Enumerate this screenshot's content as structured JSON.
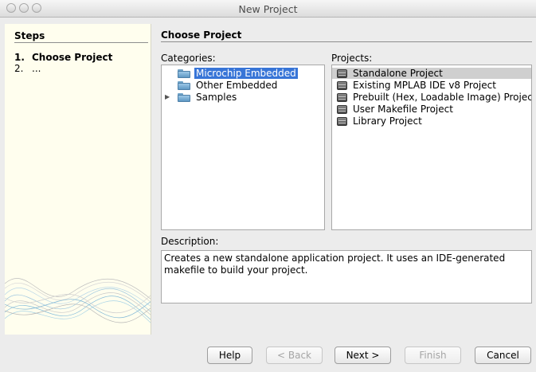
{
  "window": {
    "title": "New Project"
  },
  "steps": {
    "heading": "Steps",
    "items": [
      {
        "num": "1.",
        "label": "Choose Project"
      },
      {
        "num": "2.",
        "label": "..."
      }
    ]
  },
  "main": {
    "heading": "Choose Project",
    "categories_label": "Categories:",
    "projects_label": "Projects:",
    "categories": [
      {
        "label": "Microchip Embedded",
        "icon": "folder-icon",
        "selected": true
      },
      {
        "label": "Other Embedded",
        "icon": "folder-icon",
        "selected": false
      },
      {
        "label": "Samples",
        "icon": "folder-icon",
        "selected": false,
        "expandable": true
      }
    ],
    "projects": [
      {
        "label": "Standalone Project",
        "icon": "chip-icon",
        "selected": true
      },
      {
        "label": "Existing MPLAB IDE v8 Project",
        "icon": "chip-icon"
      },
      {
        "label": "Prebuilt (Hex, Loadable Image) Project",
        "icon": "chip-icon"
      },
      {
        "label": "User Makefile Project",
        "icon": "chip-icon"
      },
      {
        "label": "Library Project",
        "icon": "chip-icon"
      }
    ],
    "description_label": "Description:",
    "description": "Creates a new standalone application project. It uses an IDE-generated makefile to build your project."
  },
  "buttons": {
    "help": "Help",
    "back": "< Back",
    "next": "Next >",
    "finish": "Finish",
    "cancel": "Cancel"
  },
  "colors": {
    "selection": "#3875d7",
    "steps_background": "#fffeee",
    "window_background": "#ececec"
  }
}
